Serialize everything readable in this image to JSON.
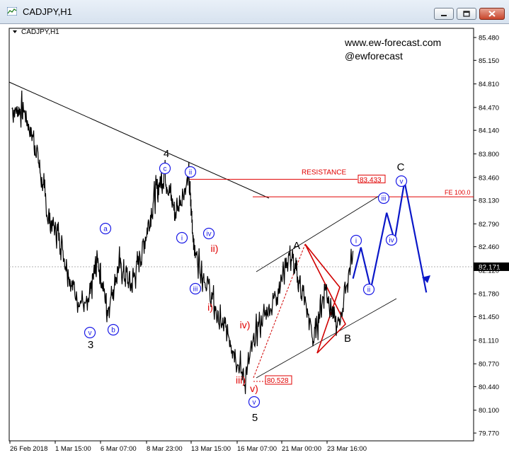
{
  "window": {
    "title": "CADJPY,H1",
    "minimize_icon": "minimize-icon",
    "restore_icon": "restore-icon",
    "close_icon": "close-icon"
  },
  "chart": {
    "symbol_label": "CADJPY,H1",
    "watermark_line1": "www.ew-forecast.com",
    "watermark_line2": "@ewforecast",
    "current_price": "82.171",
    "resistance_label": "RESISTANCE",
    "resistance_value": "83.433",
    "fe_label": "FE 100.0",
    "low_value": "80.528",
    "colors": {
      "price": "#000000",
      "count_blue": "#1a1ae6",
      "count_red": "#e00000",
      "projection": "#0a17c8",
      "resistance_line": "#e00000",
      "triangle": "#d00000"
    }
  },
  "chart_data": {
    "type": "line",
    "symbol": "CADJPY",
    "timeframe": "H1",
    "y_ticks": [
      "85.480",
      "85.150",
      "84.810",
      "84.470",
      "84.140",
      "83.800",
      "83.460",
      "83.130",
      "82.790",
      "82.460",
      "82.120",
      "81.780",
      "81.450",
      "81.110",
      "80.770",
      "80.440",
      "80.100",
      "79.770"
    ],
    "x_ticks": [
      "26 Feb 2018",
      "1 Mar 15:00",
      "6 Mar 07:00",
      "8 Mar 23:00",
      "13 Mar 15:00",
      "16 Mar 07:00",
      "21 Mar 00:00",
      "23 Mar 16:00"
    ],
    "ylim": [
      79.7,
      85.7
    ],
    "price_path": [
      {
        "t": 0,
        "y": 84.45
      },
      {
        "t": 0.03,
        "y": 84.42
      },
      {
        "t": 0.06,
        "y": 83.9
      },
      {
        "t": 0.09,
        "y": 82.9
      },
      {
        "t": 0.12,
        "y": 82.6
      },
      {
        "t": 0.15,
        "y": 81.9
      },
      {
        "t": 0.19,
        "y": 81.55
      },
      {
        "t": 0.215,
        "y": 82.3
      },
      {
        "t": 0.24,
        "y": 81.55
      },
      {
        "t": 0.27,
        "y": 82.2
      },
      {
        "t": 0.3,
        "y": 81.9
      },
      {
        "t": 0.33,
        "y": 82.45
      },
      {
        "t": 0.36,
        "y": 83.2
      },
      {
        "t": 0.385,
        "y": 83.55
      },
      {
        "t": 0.41,
        "y": 82.95
      },
      {
        "t": 0.445,
        "y": 83.45
      },
      {
        "t": 0.46,
        "y": 82.4
      },
      {
        "t": 0.49,
        "y": 81.95
      },
      {
        "t": 0.52,
        "y": 81.4
      },
      {
        "t": 0.55,
        "y": 81.15
      },
      {
        "t": 0.585,
        "y": 80.53
      },
      {
        "t": 0.62,
        "y": 81.3
      },
      {
        "t": 0.66,
        "y": 81.7
      },
      {
        "t": 0.7,
        "y": 82.35
      },
      {
        "t": 0.73,
        "y": 81.85
      },
      {
        "t": 0.76,
        "y": 81.1
      },
      {
        "t": 0.79,
        "y": 81.9
      },
      {
        "t": 0.82,
        "y": 81.25
      },
      {
        "t": 0.86,
        "y": 82.4
      }
    ],
    "projection": [
      {
        "t": 0.86,
        "y": 82.0
      },
      {
        "t": 0.88,
        "y": 82.45
      },
      {
        "t": 0.905,
        "y": 81.85
      },
      {
        "t": 0.945,
        "y": 82.95
      },
      {
        "t": 0.965,
        "y": 82.55
      },
      {
        "t": 0.99,
        "y": 83.4
      },
      {
        "t": 1.045,
        "y": 81.8
      }
    ],
    "resistance": 83.433,
    "fe_100": 83.18,
    "wave_labels": {
      "blue_circled": [
        "v",
        "b",
        "a",
        "c",
        "ii",
        "i",
        "iii",
        "iv",
        "v",
        "iii",
        "iv",
        "i",
        "ii",
        "v"
      ],
      "red": [
        "ii)",
        "i)",
        "iv)",
        "iii)",
        "v)"
      ],
      "black": [
        "3",
        "4",
        "5",
        "A",
        "B",
        "C"
      ]
    }
  }
}
